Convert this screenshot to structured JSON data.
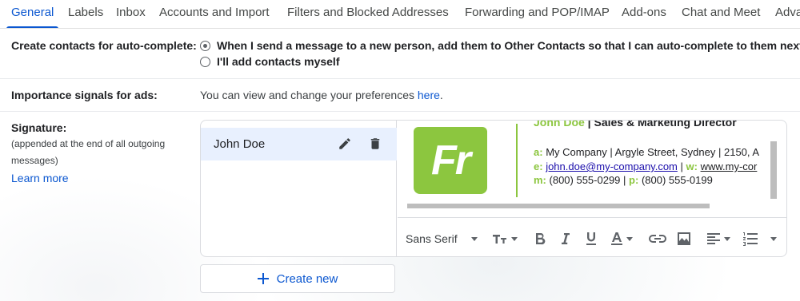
{
  "tabs": [
    {
      "label": "General",
      "active": true
    },
    {
      "label": "Labels"
    },
    {
      "label": "Inbox"
    },
    {
      "label": "Accounts and Import"
    },
    {
      "label": "Filters and Blocked Addresses"
    },
    {
      "label": "Forwarding and POP/IMAP"
    },
    {
      "label": "Add-ons"
    },
    {
      "label": "Chat and Meet"
    },
    {
      "label": "Adva"
    }
  ],
  "autocomplete": {
    "label": "Create contacts for auto-complete:",
    "option1": "When I send a message to a new person, add them to Other Contacts so that I can auto-complete to them next t",
    "option2": "I'll add contacts myself"
  },
  "ads": {
    "label": "Importance signals for ads:",
    "text": "You can view and change your preferences ",
    "link": "here",
    "period": "."
  },
  "signature": {
    "label": "Signature:",
    "note": "(appended at the end of all outgoing messages)",
    "learn_more": "Learn more",
    "list": [
      {
        "name": "John Doe"
      }
    ],
    "content": {
      "logo_text": "Fr",
      "header_name": "John Doe",
      "header_sep": " | ",
      "header_role": "Sales & Marketing Director",
      "a_key": "a:",
      "address": "My Company | Argyle Street, Sydney | 2150, A",
      "e_key": "e:",
      "email": "john.doe@my-company.com",
      "pipe": " | ",
      "w_key": "w:",
      "website": "www.my-cor",
      "m_key": "m:",
      "mobile": "(800) 555-0299",
      "p_key": "p:",
      "phone": "(800) 555-0199"
    },
    "toolbar": {
      "font": "Sans Serif"
    },
    "create_new": "Create new"
  },
  "colors": {
    "accent": "#0b57d0",
    "brand_green": "#8cc63f",
    "selected_bg": "#e8f0fe"
  },
  "icons": [
    "pencil-icon",
    "trash-icon",
    "font-size-icon",
    "bold-icon",
    "italic-icon",
    "underline-icon",
    "text-color-icon",
    "link-icon",
    "image-icon",
    "align-icon",
    "numbered-list-icon",
    "more-formatting-icon",
    "plus-icon"
  ]
}
